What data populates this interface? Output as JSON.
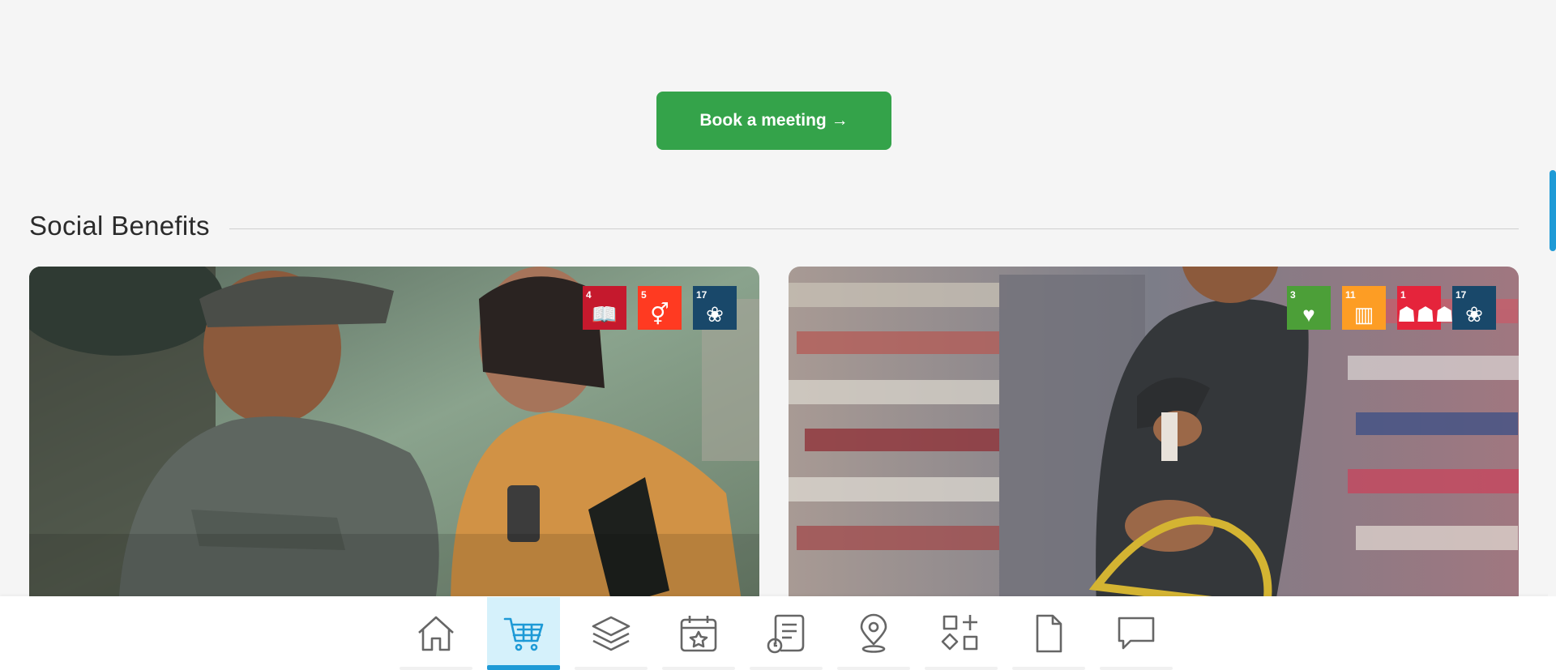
{
  "cta": {
    "label": "Book a meeting →"
  },
  "section": {
    "title": "Social Benefits"
  },
  "cards": [
    {
      "sdgs": [
        {
          "number": "4",
          "color": "#c5192d",
          "icon": "book-icon"
        },
        {
          "number": "5",
          "color": "#ff3a21",
          "icon": "gender-icon"
        },
        {
          "number": "17",
          "color": "#19486a",
          "icon": "partnership-icon"
        }
      ]
    },
    {
      "sdgs": [
        {
          "number": "3",
          "color": "#4c9f38",
          "icon": "heartbeat-icon"
        },
        {
          "number": "11",
          "color": "#fd9d24",
          "icon": "city-icon"
        },
        {
          "number": "1",
          "color": "#e5243b",
          "icon": "family-icon"
        },
        {
          "number": "17",
          "color": "#19486a",
          "icon": "partnership-icon"
        }
      ]
    }
  ],
  "bottom_nav": {
    "items": [
      {
        "icon": "home-icon",
        "active": false
      },
      {
        "icon": "cart-icon",
        "active": true
      },
      {
        "icon": "layers-icon",
        "active": false
      },
      {
        "icon": "calendar-star-icon",
        "active": false
      },
      {
        "icon": "receipt-clock-icon",
        "active": false
      },
      {
        "icon": "location-pin-icon",
        "active": false
      },
      {
        "icon": "apps-add-icon",
        "active": false
      },
      {
        "icon": "document-icon",
        "active": false
      },
      {
        "icon": "chat-icon",
        "active": false
      }
    ]
  },
  "colors": {
    "accent_green": "#34a34a",
    "accent_blue": "#1e9ad6"
  }
}
